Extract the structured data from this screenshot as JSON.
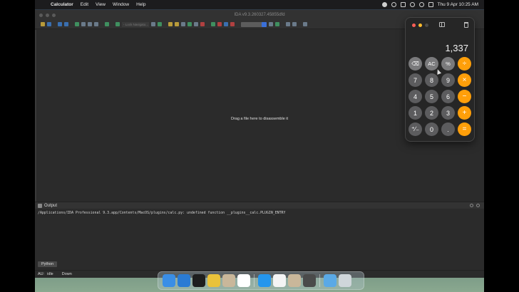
{
  "menubar": {
    "app_name": "Calculator",
    "items": [
      "Edit",
      "View",
      "Window",
      "Help"
    ],
    "clock": "Thu 9 Apr  10:25 AM"
  },
  "ida": {
    "window_title": "IDA v9.3.260327.45855dfd",
    "toolbar_field_placeholder": "- Lock Navigato...",
    "main_hint": "Drag a file here to disassemble it",
    "output_title": "Output",
    "output_line": "/Applications/IDA Professional 9.3.app/Contents/MacOS/plugins/calc.py: undefined function __plugins__calc.PLUGIN_ENTRY",
    "python_tab": "Python",
    "status": {
      "au_label": "AU:",
      "au_value": "idle",
      "direction": "Down"
    }
  },
  "calculator": {
    "display": "1,337",
    "keys": [
      {
        "label": "⌫",
        "kind": "fn",
        "name": "backspace-key"
      },
      {
        "label": "AC",
        "kind": "fn",
        "name": "all-clear-key"
      },
      {
        "label": "%",
        "kind": "fn",
        "name": "percent-key"
      },
      {
        "label": "÷",
        "kind": "op",
        "name": "divide-key"
      },
      {
        "label": "7",
        "kind": "num",
        "name": "digit-7-key"
      },
      {
        "label": "8",
        "kind": "num",
        "name": "digit-8-key"
      },
      {
        "label": "9",
        "kind": "num",
        "name": "digit-9-key"
      },
      {
        "label": "×",
        "kind": "op",
        "name": "multiply-key"
      },
      {
        "label": "4",
        "kind": "num",
        "name": "digit-4-key"
      },
      {
        "label": "5",
        "kind": "num",
        "name": "digit-5-key"
      },
      {
        "label": "6",
        "kind": "num",
        "name": "digit-6-key"
      },
      {
        "label": "−",
        "kind": "op",
        "name": "subtract-key"
      },
      {
        "label": "1",
        "kind": "num",
        "name": "digit-1-key"
      },
      {
        "label": "2",
        "kind": "num",
        "name": "digit-2-key"
      },
      {
        "label": "3",
        "kind": "num",
        "name": "digit-3-key"
      },
      {
        "label": "+",
        "kind": "op",
        "name": "add-key"
      },
      {
        "label": "⁺∕₋",
        "kind": "num",
        "name": "sign-toggle-key"
      },
      {
        "label": "0",
        "kind": "num",
        "name": "digit-0-key"
      },
      {
        "label": ".",
        "kind": "num",
        "name": "decimal-key"
      },
      {
        "label": "=",
        "kind": "op",
        "name": "equals-key"
      }
    ],
    "colors": {
      "operator": "#ff9f0a",
      "number": "#5c5c5e",
      "function": "#7a7a7c"
    }
  },
  "dock": {
    "apps": [
      {
        "name": "finder-icon",
        "color": "#3a8ee6"
      },
      {
        "name": "vscode-icon",
        "color": "#2a7bd4"
      },
      {
        "name": "terminal-icon",
        "color": "#1e1e1e"
      },
      {
        "name": "chrome-icon",
        "color": "#e9c23a"
      },
      {
        "name": "ida-icon",
        "color": "#c9b79a"
      },
      {
        "name": "slack-icon",
        "color": "#ffffff"
      },
      {
        "name": "sep",
        "color": ""
      },
      {
        "name": "docker-icon",
        "color": "#2496ed"
      },
      {
        "name": "reminders-icon",
        "color": "#f4f4f4"
      },
      {
        "name": "ida-icon-2",
        "color": "#c9b79a"
      },
      {
        "name": "calculator-icon",
        "color": "#4a4a4a"
      },
      {
        "name": "sep",
        "color": ""
      },
      {
        "name": "downloads-folder-icon",
        "color": "#5aa9e6"
      },
      {
        "name": "trash-icon",
        "color": "#cfd6da"
      }
    ]
  }
}
